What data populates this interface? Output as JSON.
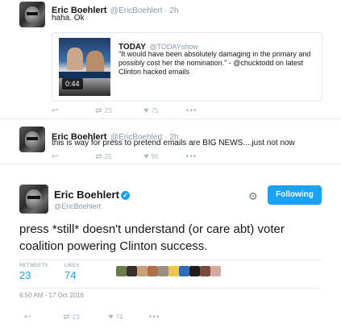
{
  "reply1": {
    "author_name": "Eric Boehlert",
    "author_handle": "@EricBoehlert · 2h",
    "text": "haha. Ok",
    "quote": {
      "author_name": "TODAY",
      "author_handle": "@TODAYshow",
      "text": "\"It would have been absolutely damaging in the primary and possibly cost her the nomination.\" - @chucktodd on latest Clinton hacked emails",
      "video_duration": "0:44"
    },
    "retweets": "23",
    "likes": "75"
  },
  "reply2": {
    "author_name": "Eric Boehlert",
    "author_handle": "@EricBoehlert · 2h",
    "text": "this is way for press to pretend emails are BIG NEWS....just not now",
    "retweets": "25",
    "likes": "96"
  },
  "main": {
    "author_name": "Eric Boehlert",
    "author_handle": "@EricBoehlert",
    "follow_label": "Following",
    "text": "press *still* doesn't understand (or care abt) voter coalition powering Clinton success.",
    "retweets_label": "RETWEETS",
    "retweets": "23",
    "likes_label": "LIKES",
    "likes": "74",
    "timestamp": "6:50 AM - 17 Oct 2016",
    "action_retweets": "23",
    "action_likes": "74",
    "liker_colors": [
      "#6b7d4a",
      "#3b2f2a",
      "#c8a07c",
      "#b06e4a",
      "#9c8f82",
      "#f4c542",
      "#2e6db4",
      "#1e1e1e",
      "#7a4a3a",
      "#d8a8a0"
    ]
  },
  "icons": {
    "reply": "reply-icon",
    "retweet": "retweet-icon",
    "like": "heart-icon",
    "more": "more-icon",
    "gear": "gear-icon",
    "verified": "verified-icon"
  },
  "colors": {
    "accent": "#1da1f2",
    "muted": "#8899a6",
    "action": "#aab8c2"
  }
}
